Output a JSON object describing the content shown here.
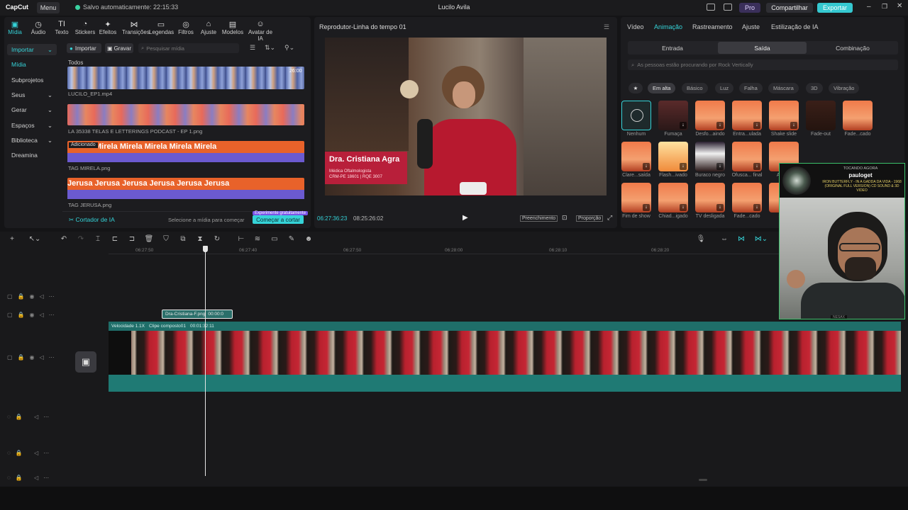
{
  "titlebar": {
    "logo": "CapCut",
    "menu": "Menu",
    "autosave": "Salvo automaticamente: 22:15:33",
    "title": "Lucilo Avila",
    "pro": "Pro",
    "share": "Compartilhar",
    "export": "Exportar"
  },
  "toolbar": {
    "items": [
      "Mídia",
      "Áudio",
      "Texto",
      "Stickers",
      "Efeitos",
      "Transições",
      "Legendas",
      "Filtros",
      "Ajuste",
      "Modelos",
      "Avatar de IA"
    ]
  },
  "sidebar": {
    "items": [
      "Importar",
      "Mídia",
      "Subprojetos",
      "Seus",
      "Gerar",
      "Espaços",
      "Biblioteca",
      "Dreamina"
    ]
  },
  "media": {
    "import_btn": "Importar",
    "record_btn": "Gravar",
    "search_placeholder": "Pesquisar mídia",
    "section": "Todos",
    "files": [
      "LUCILO_EP1.mp4",
      "LA 35338 TELAS E LETTERINGS PODCAST - EP 1.png",
      "TAG MIRELA.png",
      "TAG JERUSA.png"
    ],
    "duration": "26:00",
    "added_badge": "Adicionado",
    "strip3_text": "Mirela",
    "strip4_text": "Jerusa",
    "ai_cutter": "Cortador de IA",
    "ai_hint": "Selecione a mídia para começar",
    "try_free": "Experimente gratuitamente",
    "start_cut": "Começar a cortar"
  },
  "player": {
    "title": "Reprodutor-Linha do tempo 01",
    "name": "Dra. Cristiana Agra",
    "name_sub1": "Médica Oftalmologista",
    "name_sub2": "CRM-PE 18601 | RQE 3007",
    "current": "06:27:36:23",
    "total": "08:25:26:02",
    "fill": "Preenchimento",
    "ratio": "Proporção"
  },
  "right": {
    "tabs": [
      "Vídeo",
      "Animação",
      "Rastreamento",
      "Ajuste",
      "Estilização de IA"
    ],
    "segments": [
      "Entrada",
      "Saída",
      "Combinação"
    ],
    "search_placeholder": "As pessoas estão procurando por Rock Vertically",
    "chips": [
      "Em alta",
      "Básico",
      "Luz",
      "Falha",
      "Máscara",
      "3D",
      "Vibração"
    ],
    "anims_row1": [
      "Nenhum",
      "Fumaça",
      "Desfo...aindo",
      "Entra...ulada",
      "Shake slide",
      "Fade-out",
      "Fade...cado"
    ],
    "anims_row2": [
      "Clare...saída",
      "Flash...ivado",
      "Buraco negro",
      "Ofusca... final",
      "Aum...",
      "",
      ""
    ],
    "anims_row3": [
      "Fim de show",
      "Chiad...igado",
      "TV desligada",
      "Fade...cado",
      "Sw..."
    ]
  },
  "timeline": {
    "ticks": [
      "06:27:50",
      "06:27:40",
      "06:27:50",
      "06:28:00",
      "06:28:10",
      "06:28:20"
    ],
    "overlay_clip": "Dra-Cristiana-F.png",
    "overlay_time": "00:00:0",
    "speed": "Velocidade 1.1X",
    "compound": "Clipe composto01",
    "compound_time": "00:01:32:11"
  },
  "webcam": {
    "label": "TOCANDO AGORA",
    "user": "pauloget",
    "song": "IRON BUTTERFLY - IN A GADDA DA VIDA - 1968 (ORIGINAL FULL VERSION) CD SOUND & 3D VIDEO",
    "tag": "NESAX"
  }
}
